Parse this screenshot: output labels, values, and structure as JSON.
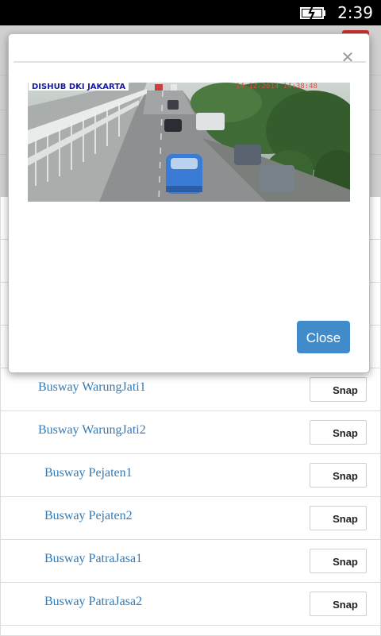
{
  "status_bar": {
    "time": "2:39",
    "battery_icon": "battery-charging-icon"
  },
  "modal": {
    "close_icon": "close-icon",
    "camera": {
      "label": "DISHUB DKI JAKARTA",
      "timestamp": "14-12-2014 14:38:48"
    },
    "close_button_label": "Close"
  },
  "busway_list": [
    {
      "name": "Busway WarungJati1",
      "snap_label": "Snap"
    },
    {
      "name": "Busway WarungJati2",
      "snap_label": "Snap"
    },
    {
      "name": "Busway Pejaten1",
      "snap_label": "Snap"
    },
    {
      "name": "Busway Pejaten2",
      "snap_label": "Snap"
    },
    {
      "name": "Busway PatraJasa1",
      "snap_label": "Snap"
    },
    {
      "name": "Busway PatraJasa2",
      "snap_label": "Snap"
    }
  ],
  "colors": {
    "link": "#337ab7",
    "primary_button": "#428bca",
    "danger_button": "#c9302c"
  }
}
